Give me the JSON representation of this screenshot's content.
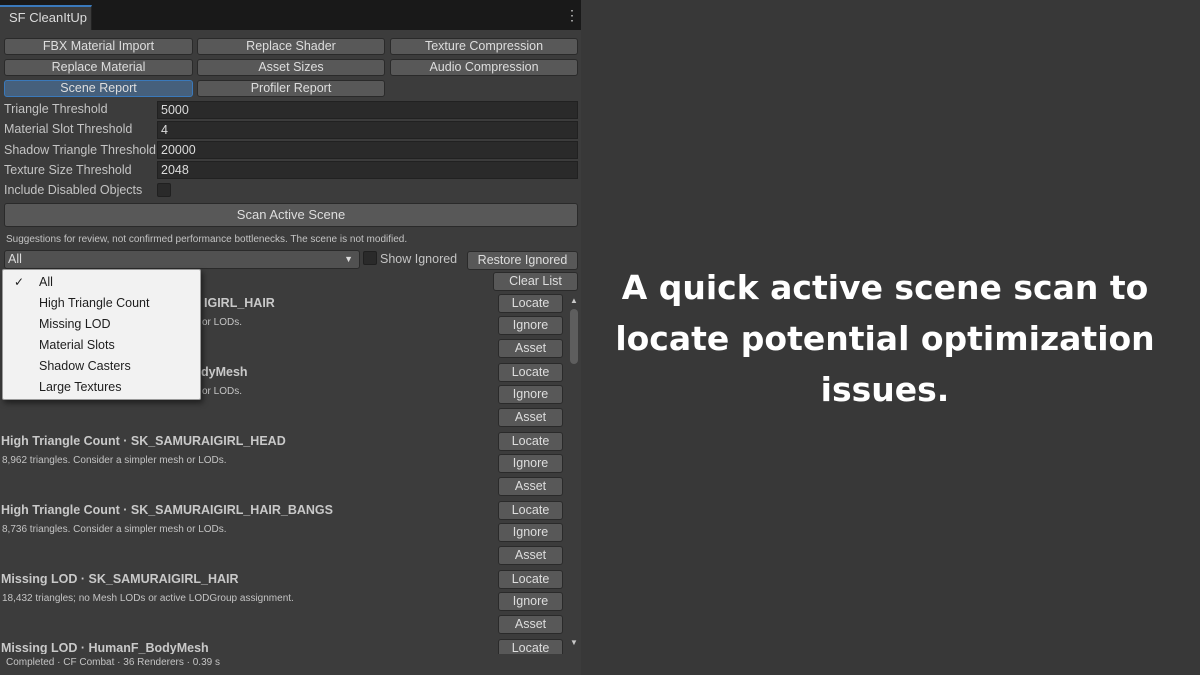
{
  "window": {
    "tab_title": "SF CleanItUp",
    "menu_icon": "kebab-menu-icon"
  },
  "tool_buttons": [
    {
      "label": "FBX Material Import",
      "selected": false
    },
    {
      "label": "Replace Shader",
      "selected": false
    },
    {
      "label": "Texture Compression",
      "selected": false
    },
    {
      "label": "Replace Material",
      "selected": false
    },
    {
      "label": "Asset Sizes",
      "selected": false
    },
    {
      "label": "Audio Compression",
      "selected": false
    },
    {
      "label": "Scene Report",
      "selected": true
    },
    {
      "label": "Profiler Report",
      "selected": false
    }
  ],
  "settings": [
    {
      "label": "Triangle Threshold",
      "value": "5000"
    },
    {
      "label": "Material Slot Threshold",
      "value": "4"
    },
    {
      "label": "Shadow Triangle Threshold",
      "value": "20000"
    },
    {
      "label": "Texture Size Threshold",
      "value": "2048"
    }
  ],
  "include_disabled": {
    "label": "Include Disabled Objects",
    "checked": false
  },
  "scan_button": "Scan Active Scene",
  "hint": "Suggestions for review, not confirmed performance bottlenecks. The scene is not modified.",
  "filter": {
    "selected": "All",
    "options": [
      "All",
      "High Triangle Count",
      "Missing LOD",
      "Material Slots",
      "Shadow Casters",
      "Large Textures"
    ],
    "checkmark": "✓"
  },
  "show_ignored": {
    "label": "Show Ignored",
    "checked": false
  },
  "restore_ignored": "Restore Ignored",
  "clear_list": "Clear List",
  "row_buttons": {
    "locate": "Locate",
    "ignore": "Ignore",
    "asset": "Asset"
  },
  "results": [
    {
      "title": "High Triangle Count · SK_SAMURAIGIRL_HAIR",
      "visible_title": "IGIRL_HAIR",
      "visible_desc": "or LODs."
    },
    {
      "title": "High Triangle Count · HumanF_BodyMesh",
      "visible_title": "dyMesh",
      "visible_desc": "or LODs."
    },
    {
      "title": "High Triangle Count · SK_SAMURAIGIRL_HEAD",
      "desc": "8,962 triangles. Consider a simpler mesh or LODs."
    },
    {
      "title": "High Triangle Count · SK_SAMURAIGIRL_HAIR_BANGS",
      "desc": "8,736 triangles. Consider a simpler mesh or LODs."
    },
    {
      "title": "Missing LOD · SK_SAMURAIGIRL_HAIR",
      "desc": "18,432 triangles; no Mesh LODs or active LODGroup assignment."
    },
    {
      "title": "Missing LOD · HumanF_BodyMesh"
    }
  ],
  "status": "Completed · CF Combat · 36 Renderers · 0.39 s",
  "caption": "A quick active scene scan to locate potential optimization issues.",
  "colors": {
    "accent": "#3a79bb",
    "selected_button": "#46607c",
    "panel": "#3c3c3c",
    "background": "#383838"
  }
}
